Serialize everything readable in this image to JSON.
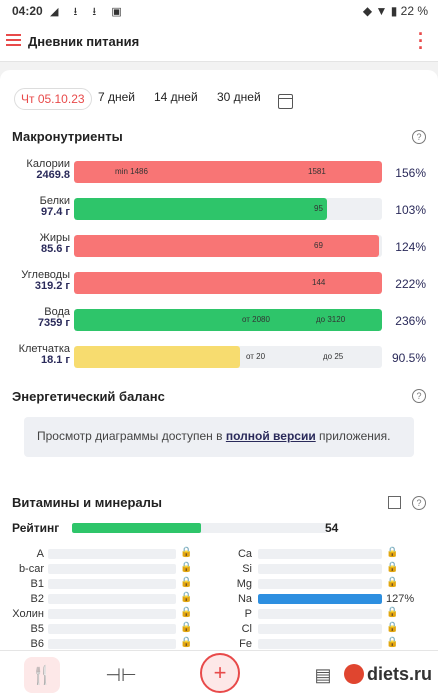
{
  "status_bar": {
    "time": "04:20",
    "battery": "22 %"
  },
  "app_bar": {
    "title": "Дневник питания"
  },
  "periods": {
    "selected": "Чт 05.10.23",
    "options": [
      "7 дней",
      "14 дней",
      "30 дней"
    ]
  },
  "macros": {
    "title": "Макронутриенты",
    "rows": [
      {
        "name": "Калории",
        "amount": "2469.8",
        "fraction": 1.0,
        "color": "#f87575",
        "markers": [
          "min 1486",
          "1581"
        ],
        "percent": "156%"
      },
      {
        "name": "Белки",
        "amount": "97.4 г",
        "fraction": 0.82,
        "color": "#2ec56a",
        "markers": [
          "95"
        ],
        "percent": "103%"
      },
      {
        "name": "Жиры",
        "amount": "85.6 г",
        "fraction": 0.99,
        "color": "#f87575",
        "markers": [
          "69"
        ],
        "percent": "124%"
      },
      {
        "name": "Углеводы",
        "amount": "319.2 г",
        "fraction": 1.0,
        "color": "#f87575",
        "markers": [
          "144"
        ],
        "percent": "222%"
      },
      {
        "name": "Вода",
        "amount": "7359 г",
        "fraction": 1.0,
        "color": "#2ec56a",
        "markers": [
          "от 2080",
          "до 3120"
        ],
        "percent": "236%"
      },
      {
        "name": "Клетчатка",
        "amount": "18.1 г",
        "fraction": 0.54,
        "color": "#f7dc6f",
        "markers": [
          "от 20",
          "до 25"
        ],
        "percent": "90.5%"
      }
    ]
  },
  "energy": {
    "title": "Энергетический баланс",
    "note_before": "Просмотр диаграммы доступен в ",
    "note_link": "полной версии",
    "note_after": " приложения."
  },
  "vitamins": {
    "title": "Витамины и минералы",
    "rating_label": "Рейтинг",
    "rating_value": "54",
    "rating_fraction": 0.54,
    "left": [
      "A",
      "b-car",
      "B1",
      "B2",
      "Холин",
      "B5",
      "B6"
    ],
    "right": [
      {
        "name": "Ca",
        "fraction": 0,
        "percent": ""
      },
      {
        "name": "Si",
        "fraction": 0,
        "percent": ""
      },
      {
        "name": "Mg",
        "fraction": 0,
        "percent": ""
      },
      {
        "name": "Na",
        "fraction": 1.0,
        "percent": "127%"
      },
      {
        "name": "P",
        "fraction": 0,
        "percent": ""
      },
      {
        "name": "Cl",
        "fraction": 0,
        "percent": ""
      },
      {
        "name": "Fe",
        "fraction": 0,
        "percent": ""
      }
    ]
  },
  "watermark": "diets.ru"
}
